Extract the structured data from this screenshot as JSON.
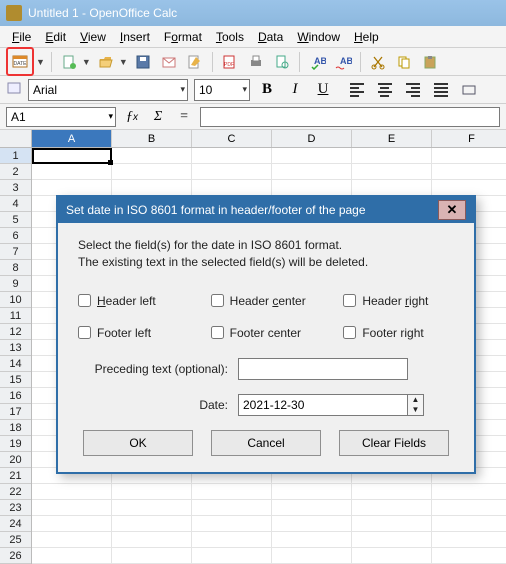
{
  "app": {
    "title": "Untitled 1 - OpenOffice Calc"
  },
  "menu": {
    "file": "File",
    "edit": "Edit",
    "view": "View",
    "insert": "Insert",
    "format": "Format",
    "tools": "Tools",
    "data": "Data",
    "window": "Window",
    "help": "Help"
  },
  "format_bar": {
    "font_name": "Arial",
    "font_size": "10",
    "bold": "B",
    "italic": "I",
    "underline": "U"
  },
  "cell_ref": {
    "name": "A1"
  },
  "columns": [
    "A",
    "B",
    "C",
    "D",
    "E",
    "F"
  ],
  "rows": [
    "1",
    "2",
    "3",
    "4",
    "5",
    "6",
    "7",
    "8",
    "9",
    "10",
    "11",
    "12",
    "13",
    "14",
    "15",
    "16",
    "17",
    "18",
    "19",
    "20",
    "21",
    "22",
    "23",
    "24",
    "25",
    "26"
  ],
  "selected_col": "A",
  "selected_row": "1",
  "dialog": {
    "title": "Set date in ISO 8601 format in header/footer of the page",
    "msg1": "Select the field(s) for the date in ISO 8601 format.",
    "msg2": "The existing text in the selected field(s) will be deleted.",
    "checks": {
      "hl": "Header left",
      "hc": "Header center",
      "hr": "Header right",
      "fl": "Footer left",
      "fc": "Footer center",
      "fr": "Footer right"
    },
    "preceding_label": "Preceding text (optional):",
    "preceding_value": "",
    "date_label": "Date:",
    "date_value": "2021-12-30",
    "ok": "OK",
    "cancel": "Cancel",
    "clear": "Clear Fields"
  },
  "icons": {
    "ext": "ext-icon",
    "new": "new-doc",
    "open": "open",
    "save": "save",
    "mail": "mail",
    "pdf": "export-pdf",
    "print": "print",
    "preview": "print-preview",
    "spell": "spellcheck",
    "autospell": "auto-spellcheck",
    "cut": "cut",
    "copy": "copy",
    "paste": "paste"
  }
}
